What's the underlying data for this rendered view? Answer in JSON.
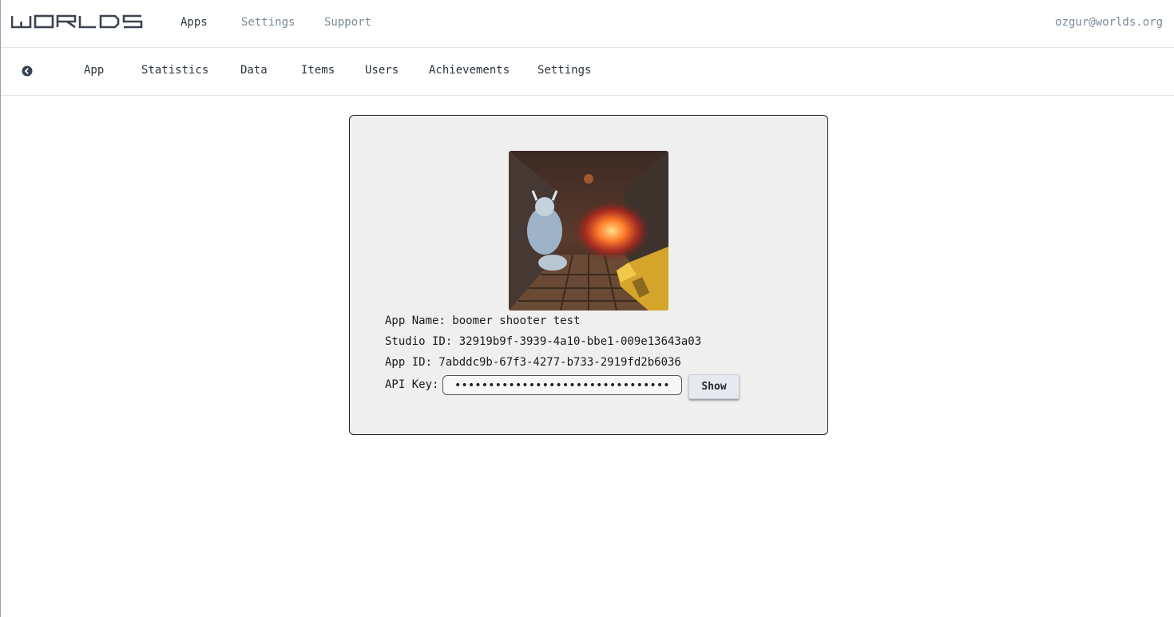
{
  "header": {
    "logo_text": "WORLDS",
    "nav": [
      {
        "label": "Apps",
        "active": true
      },
      {
        "label": "Settings",
        "active": false
      },
      {
        "label": "Support",
        "active": false
      }
    ],
    "user_email": "ozgur@worlds.org"
  },
  "subnav": {
    "back_icon": "back-arrow-circle-icon",
    "tabs": [
      "App",
      "Statistics",
      "Data",
      "Items",
      "Users",
      "Achievements",
      "Settings"
    ]
  },
  "app_card": {
    "app_name_line": "App Name: boomer shooter test",
    "studio_id_line": "Studio ID: 32919b9f-3939-4a10-bbe1-009e13643a03",
    "app_id_line": "App ID: 7abddc9b-67f3-4277-b733-2919fd2b6036",
    "api_key_label": "API Key:",
    "api_key_value": "••••••••••••••••••••••••••••••••••••",
    "show_button_label": "Show"
  },
  "colors": {
    "card_bg": "#efefef",
    "text_muted": "#7a8a99",
    "text_main": "#2b3440"
  }
}
